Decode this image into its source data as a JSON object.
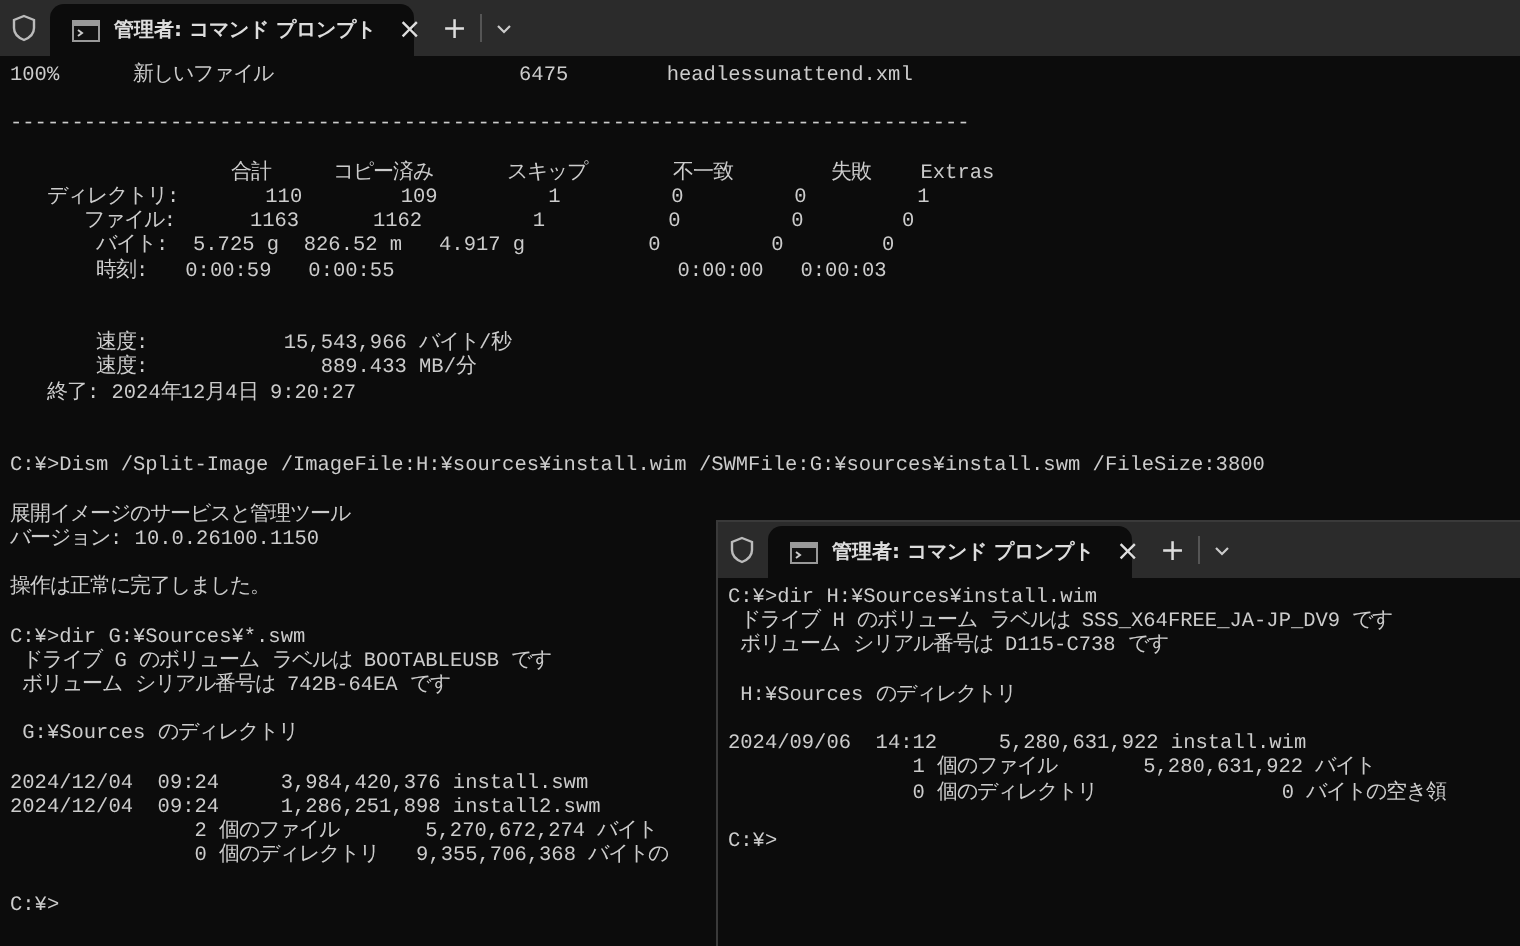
{
  "windows": [
    {
      "tab": {
        "title": "管理者: コマンド プロンプト",
        "selected": true
      },
      "close": "×",
      "new_tab": "+",
      "blocks": [
        {
          "kind": "plain",
          "lines": [
            "100%      新しいファイル                    6475        headlessunattend.xml"
          ]
        },
        {
          "kind": "plain",
          "lines": [
            "------------------------------------------------------------------------------"
          ]
        },
        {
          "kind": "spaced",
          "lines": [
            "                  合計     コピー済み      スキップ       不一致        失敗    Extras",
            "   ディレクトリ:       110        109         1         0         0         1",
            "      ファイル:      1163      1162         1          0         0        0",
            "       バイト:  5.725 g  826.52 m   4.917 g          0         0        0",
            "       時刻:   0:00:59   0:00:55                       0:00:00   0:00:03"
          ]
        },
        {
          "kind": "spaced",
          "lines": [
            "       速度:           15,543,966 バイト/秒",
            "       速度:              889.433 MB/分",
            "   終了: 2024年12月4日 9:20:27"
          ]
        },
        {
          "kind": "plain",
          "lines": [
            "C:¥>Dism /Split-Image /ImageFile:H:¥sources¥install.wim /SWMFile:G:¥sources¥install.swm /FileSize:3800"
          ]
        },
        {
          "kind": "plain",
          "lines": [
            "展開イメージのサービスと管理ツール",
            "バージョン: 10.0.26100.1150"
          ]
        },
        {
          "kind": "plain",
          "lines": [
            "操作は正常に完了しました。"
          ]
        },
        {
          "kind": "plain",
          "lines": [
            "C:¥>dir G:¥Sources¥*.swm",
            " ドライブ G のボリューム ラベルは BOOTABLEUSB です",
            " ボリューム シリアル番号は 742B-64EA です"
          ]
        },
        {
          "kind": "plain",
          "lines": [
            " G:¥Sources のディレクトリ"
          ]
        },
        {
          "kind": "plain",
          "lines": [
            "2024/12/04  09:24     3,984,420,376 install.swm",
            "2024/12/04  09:24     1,286,251,898 install2.swm",
            "               2 個のファイル       5,270,672,274 バイト",
            "               0 個のディレクトリ   9,355,706,368 バイトの"
          ]
        },
        {
          "kind": "plain",
          "lines": [
            "C:¥>"
          ]
        }
      ]
    },
    {
      "tab": {
        "title": "管理者: コマンド プロンプト",
        "selected": true
      },
      "close": "×",
      "new_tab": "+",
      "blocks": [
        {
          "kind": "plain",
          "lines": [
            "C:¥>dir H:¥Sources¥install.wim",
            " ドライブ H のボリューム ラベルは SSS_X64FREE_JA-JP_DV9 です",
            " ボリューム シリアル番号は D115-C738 です"
          ]
        },
        {
          "kind": "plain",
          "lines": [
            " H:¥Sources のディレクトリ"
          ]
        },
        {
          "kind": "plain",
          "lines": [
            "2024/09/06  14:12     5,280,631,922 install.wim",
            "               1 個のファイル       5,280,631,922 バイト",
            "               0 個のディレクトリ               0 バイトの空き領"
          ]
        },
        {
          "kind": "plain",
          "lines": [
            "C:¥>"
          ]
        }
      ]
    }
  ]
}
